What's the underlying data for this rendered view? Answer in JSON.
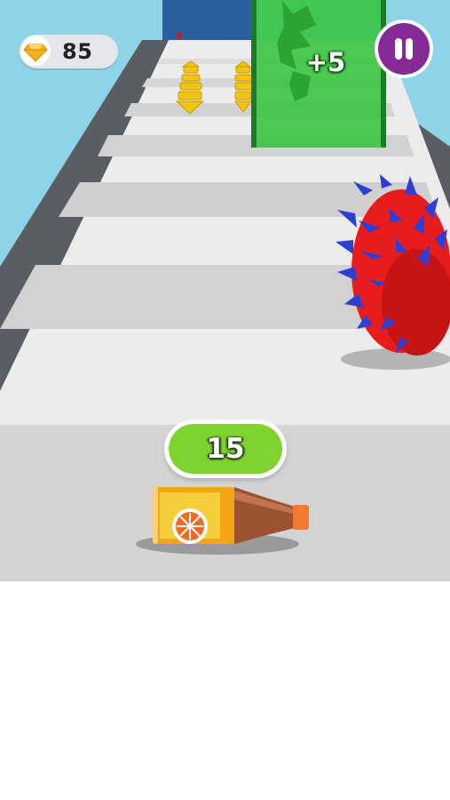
{
  "hud": {
    "gems": {
      "count": "85",
      "icon": "gem-icon",
      "color": "#f7b21c"
    },
    "pause": {
      "icon": "pause-icon",
      "color": "#862a98"
    }
  },
  "gate": {
    "bonus_label": "+5",
    "color": "#35c43c"
  },
  "player": {
    "value": "15",
    "pill_color": "#7fd331",
    "object": "orange-juice-bottle"
  },
  "obstacle": {
    "type": "spiked-roller",
    "body_color": "#e71d1d",
    "spike_color": "#2f3fd4"
  }
}
